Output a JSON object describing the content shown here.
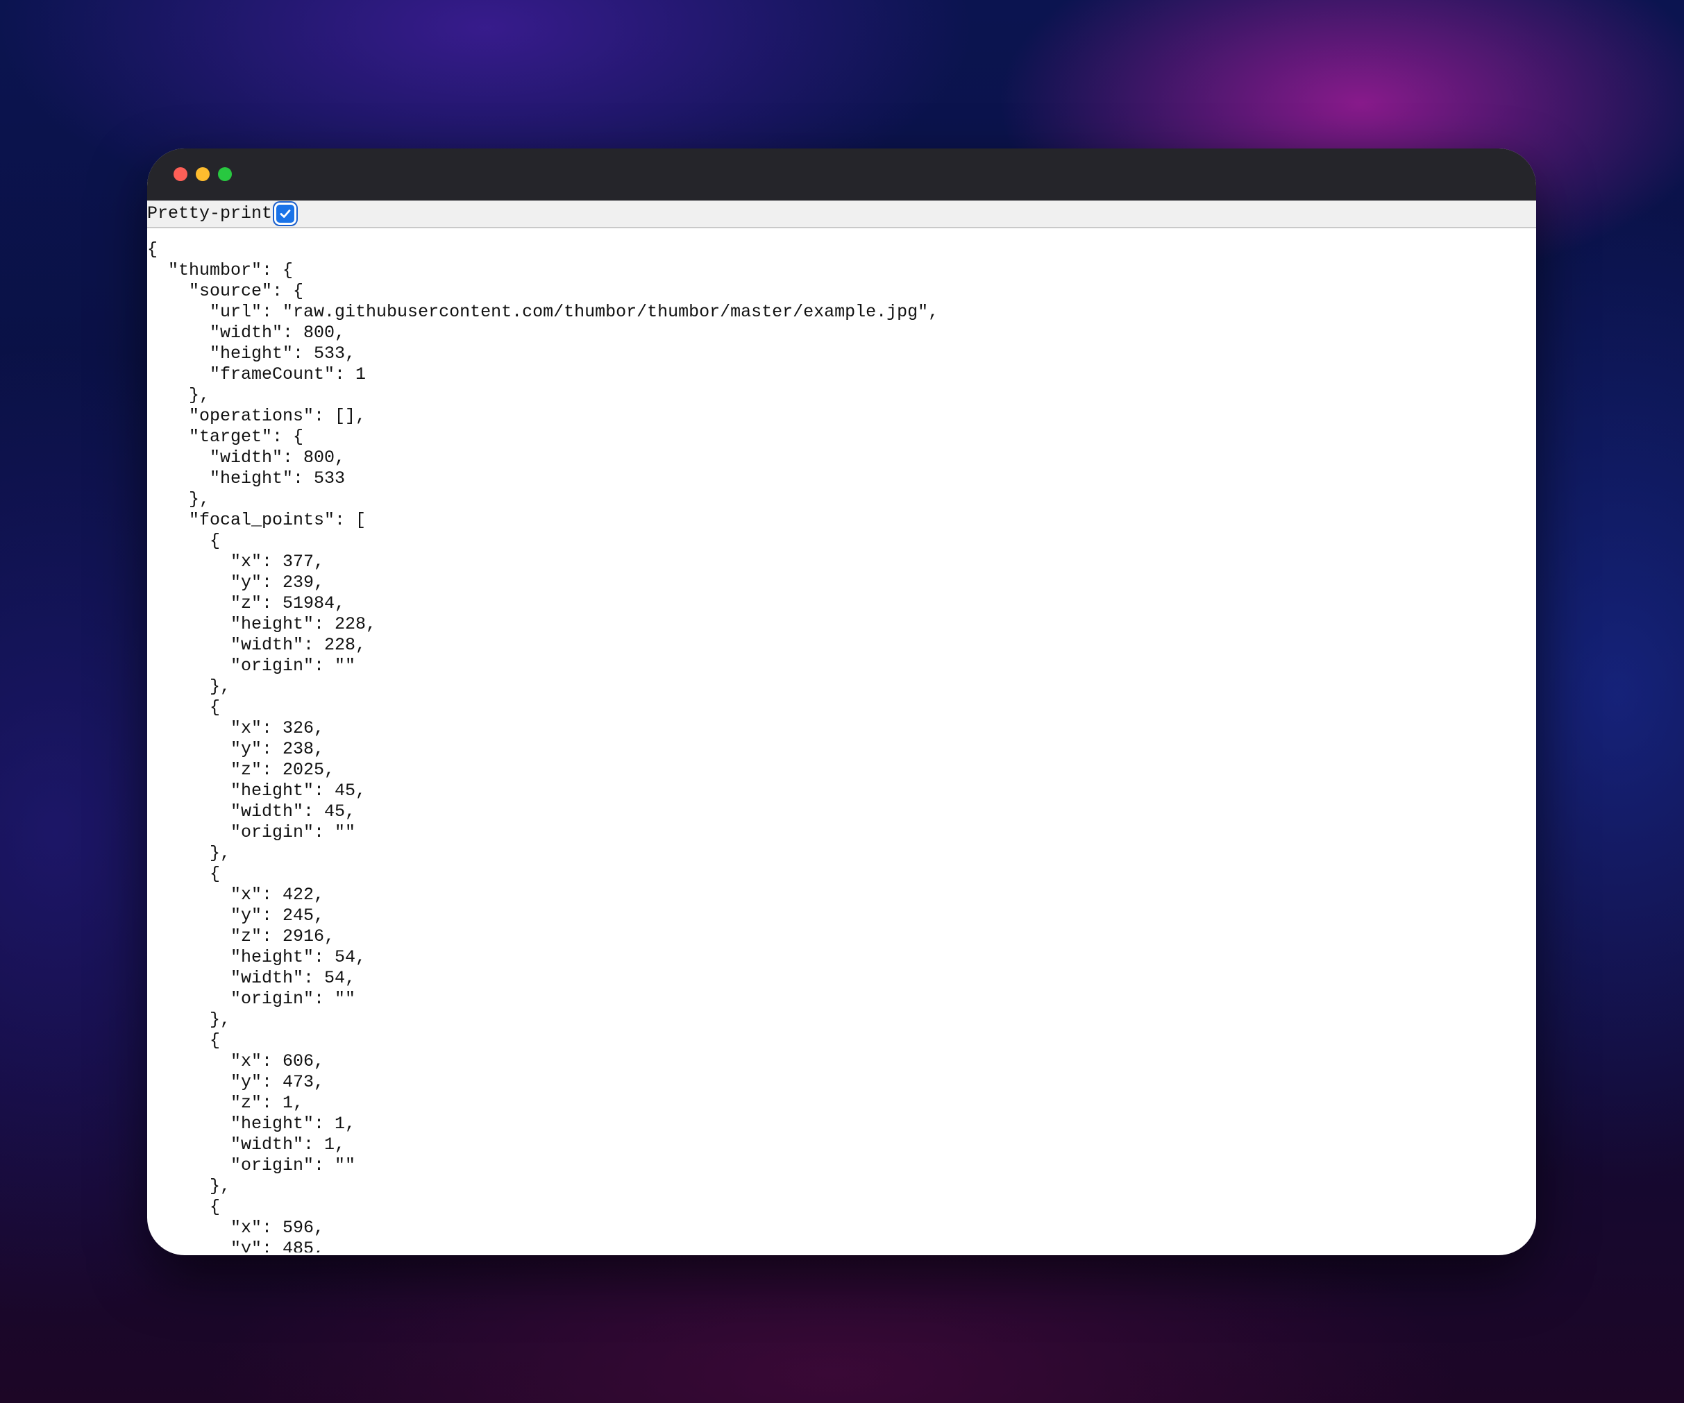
{
  "window": {
    "controls": {
      "close_color": "#fe5f57",
      "minimize_color": "#febc2e",
      "maximize_color": "#28c840"
    }
  },
  "toolbar": {
    "pretty_print_label": "Pretty-print",
    "pretty_print_checked": true
  },
  "json_view": {
    "text": "{\n  \"thumbor\": {\n    \"source\": {\n      \"url\": \"raw.githubusercontent.com/thumbor/thumbor/master/example.jpg\",\n      \"width\": 800,\n      \"height\": 533,\n      \"frameCount\": 1\n    },\n    \"operations\": [],\n    \"target\": {\n      \"width\": 800,\n      \"height\": 533\n    },\n    \"focal_points\": [\n      {\n        \"x\": 377,\n        \"y\": 239,\n        \"z\": 51984,\n        \"height\": 228,\n        \"width\": 228,\n        \"origin\": \"\"\n      },\n      {\n        \"x\": 326,\n        \"y\": 238,\n        \"z\": 2025,\n        \"height\": 45,\n        \"width\": 45,\n        \"origin\": \"\"\n      },\n      {\n        \"x\": 422,\n        \"y\": 245,\n        \"z\": 2916,\n        \"height\": 54,\n        \"width\": 54,\n        \"origin\": \"\"\n      },\n      {\n        \"x\": 606,\n        \"y\": 473,\n        \"z\": 1,\n        \"height\": 1,\n        \"width\": 1,\n        \"origin\": \"\"\n      },\n      {\n        \"x\": 596,\n        \"y\": 485,"
  }
}
